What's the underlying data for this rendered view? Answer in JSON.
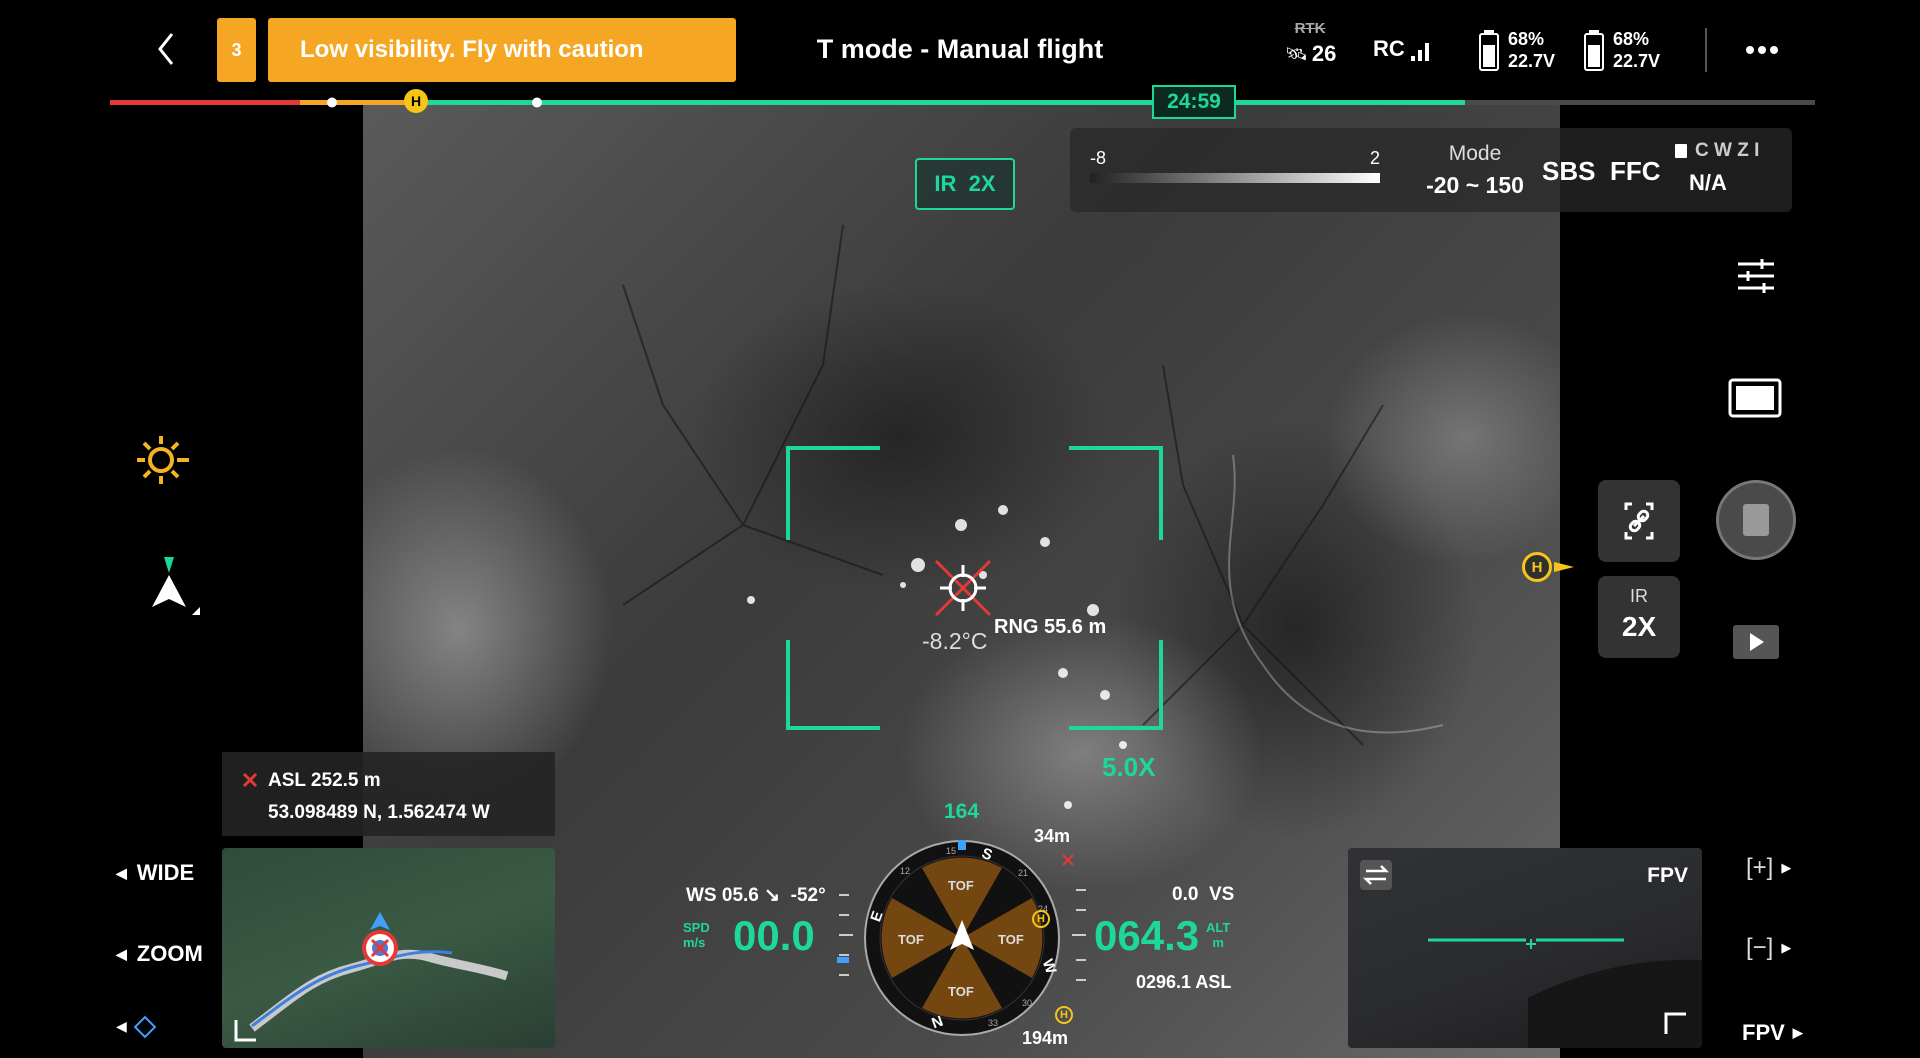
{
  "top_bar": {
    "warning_count": "3",
    "warning_text": "Low visibility. Fly with caution",
    "flight_mode": "T mode - Manual flight",
    "rtk_label": "RTK",
    "satellites": "26",
    "rc_label": "RC",
    "battery1_pct": "68%",
    "battery1_volt": "22.7V",
    "battery2_pct": "68%",
    "battery2_volt": "22.7V"
  },
  "timeline": {
    "time_remaining": "24:59",
    "home_marker": "H"
  },
  "thermal_panel": {
    "range_min": "-8",
    "range_max": "2",
    "mode_label": "Mode",
    "mode_value": "-20 ~ 150",
    "sbs_label": "SBS",
    "ffc_label": "FFC",
    "cwzi_label": "C W Z I",
    "storage_value": "N/A"
  },
  "camera_badge": "IR  2X",
  "target": {
    "temp": "-8.2°C",
    "range": "RNG 55.6 m",
    "zoom": "5.0X"
  },
  "right_side": {
    "home_marker": "H",
    "lens_label": "IR",
    "lens_zoom": "2X"
  },
  "position": {
    "asl": "ASL 252.5 m",
    "coords": "53.098489 N, 1.562474 W"
  },
  "left_buttons": {
    "wide": "WIDE",
    "zoom": "ZOOM"
  },
  "attitude": {
    "heading": "164",
    "ws": "WS 05.6 ↘  -52°",
    "spd_label": "SPD\nm/s",
    "speed": "00.0",
    "dist_top": "34m",
    "dist_bottom": "194m",
    "vs": "0.0  VS",
    "altitude": "064.3",
    "alt_label": "ALT\nm",
    "asl": "0296.1 ASL",
    "tof": [
      "TOF",
      "TOF",
      "TOF",
      "TOF"
    ],
    "compass": [
      "N",
      "E",
      "S",
      "W"
    ],
    "compass_ticks": [
      "15",
      "12",
      "21",
      "24",
      "30",
      "33"
    ]
  },
  "fpv": {
    "label": "FPV",
    "bottom_label": "FPV"
  },
  "colors": {
    "accent_orange": "#f5a623",
    "hud_green": "#1ed79a",
    "red": "#e53935"
  }
}
